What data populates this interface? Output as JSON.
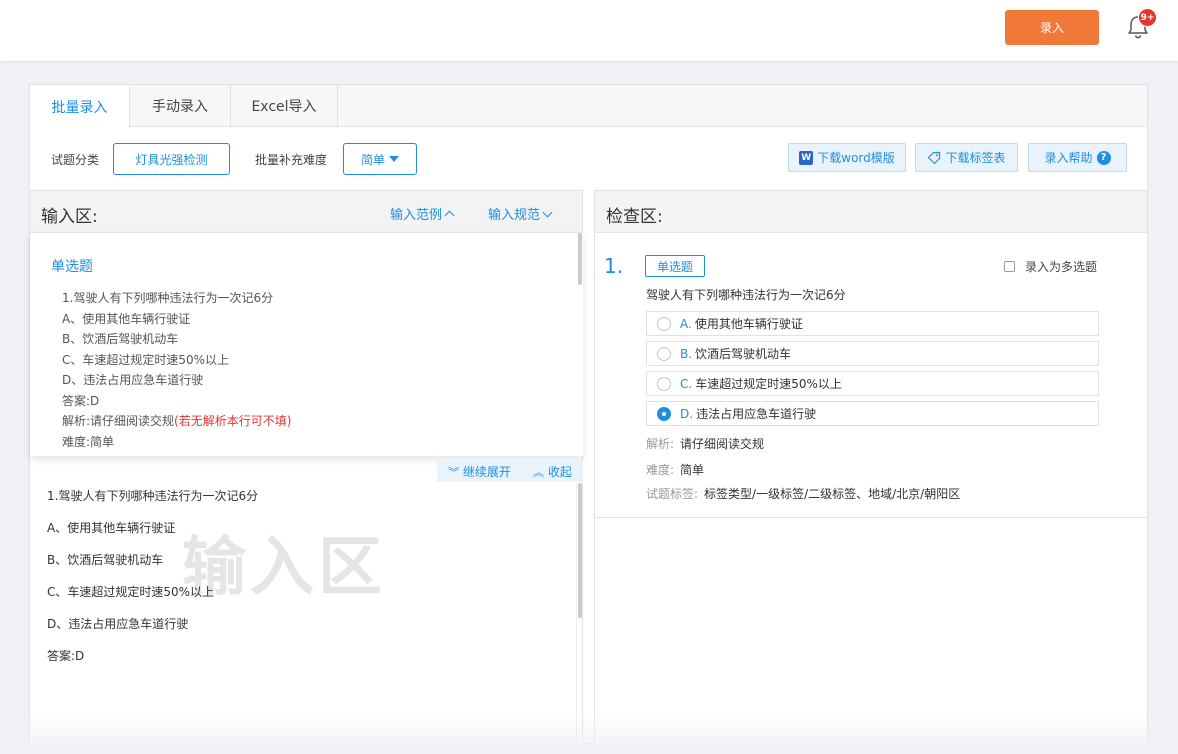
{
  "topbar": {
    "enter_label": "录入",
    "badge": "9+"
  },
  "tabs": [
    {
      "label": "批量录入"
    },
    {
      "label": "手动录入"
    },
    {
      "label": "Excel导入"
    }
  ],
  "toolbar": {
    "category_label": "试题分类",
    "category_value": "灯具光强检测",
    "difficulty_label": "批量补充难度",
    "difficulty_value": "简单",
    "download_word": "下载word模版",
    "download_tags": "下载标签表",
    "help": "录入帮助",
    "word_icon_text": "W",
    "help_icon_text": "?"
  },
  "input_panel": {
    "title": "输入区:",
    "example_link": "输入范例",
    "spec_link": "输入规范",
    "example": {
      "heading": "单选题",
      "lines": [
        "1.驾驶人有下列哪种违法行为一次记6分",
        "A、使用其他车辆行驶证",
        "B、饮酒后驾驶机动车",
        "C、车速超过规定时速50%以上",
        "D、违法占用应急车道行驶",
        "答案:D"
      ],
      "analysis_prefix": "解析:请仔细阅读交规",
      "analysis_note": "(若无解析本行可不填)",
      "difficulty_line": "难度:简单"
    },
    "expand": "继续展开",
    "collapse": "收起",
    "typed_lines": [
      "1.驾驶人有下列哪种违法行为一次记6分",
      "A、使用其他车辆行驶证",
      "B、饮酒后驾驶机动车",
      "C、车速超过规定时速50%以上",
      "D、违法占用应急车道行驶",
      "答案:D"
    ],
    "watermark": "输入区"
  },
  "check_panel": {
    "title": "检查区:",
    "question": {
      "number": "1.",
      "type": "单选题",
      "multi_label": "录入为多选题",
      "stem": "驾驶人有下列哪种违法行为一次记6分",
      "options": [
        {
          "letter": "A.",
          "text": "使用其他车辆行驶证",
          "selected": false
        },
        {
          "letter": "B.",
          "text": "饮酒后驾驶机动车",
          "selected": false
        },
        {
          "letter": "C.",
          "text": "车速超过规定时速50%以上",
          "selected": false
        },
        {
          "letter": "D.",
          "text": "违法占用应急车道行驶",
          "selected": true
        }
      ],
      "analysis_label": "解析:",
      "analysis_value": "请仔细阅读交规",
      "difficulty_label": "难度:",
      "difficulty_value": "简单",
      "tags_label": "试题标签:",
      "tags_value": "标签类型/一级标签/二级标签、地域/北京/朝阳区"
    }
  },
  "colors": {
    "accent": "#1f8ee0",
    "primary_button": "#f0793a",
    "badge": "#e8332f",
    "warning_text": "#e8332f"
  },
  "icons": [
    "bell-icon",
    "word-icon",
    "tag-icon",
    "help-icon",
    "chevron-up-icon",
    "chevron-down-icon",
    "double-chevron-down-icon",
    "double-chevron-up-icon",
    "radio-icon",
    "checkbox-icon"
  ]
}
